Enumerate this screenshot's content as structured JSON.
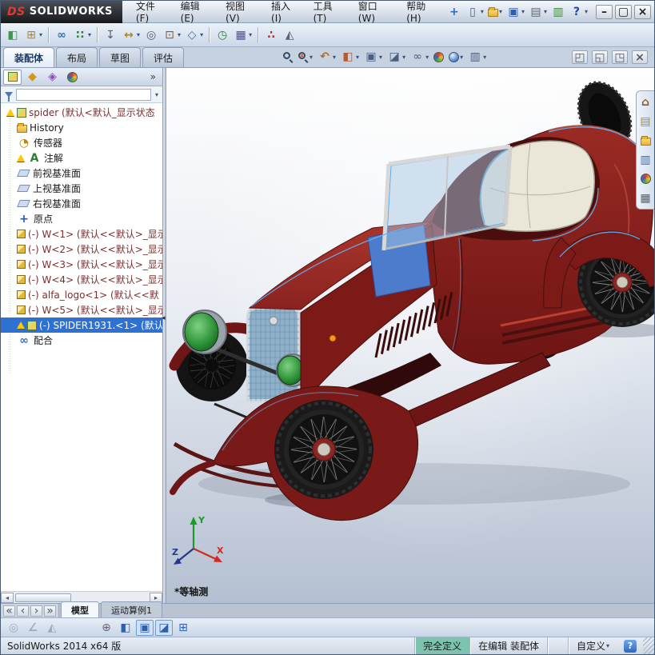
{
  "titlebar": {
    "logo_mark": "DS",
    "logo_text": "SOLIDWORKS",
    "menus": [
      {
        "name": "file",
        "label": "文件(F)"
      },
      {
        "name": "edit",
        "label": "编辑(E)"
      },
      {
        "name": "view",
        "label": "视图(V)"
      },
      {
        "name": "insert",
        "label": "插入(I)"
      },
      {
        "name": "tools",
        "label": "工具(T)"
      },
      {
        "name": "window",
        "label": "窗口(W)"
      },
      {
        "name": "help",
        "label": "帮助(H)"
      }
    ],
    "buttons": [
      {
        "name": "pin-menubar",
        "icon": "pin"
      },
      {
        "name": "new-document",
        "icon": "new-doc",
        "caret": true
      },
      {
        "name": "open-document",
        "icon": "open",
        "caret": true
      },
      {
        "name": "save-document",
        "icon": "save",
        "caret": true
      },
      {
        "name": "print-document",
        "icon": "print",
        "caret": true
      },
      {
        "name": "solidworks-resources",
        "icon": "toolbox"
      },
      {
        "name": "help",
        "label": "?",
        "caret": true
      }
    ],
    "window_buttons": [
      {
        "name": "minimize",
        "icon": "minimize"
      },
      {
        "name": "maximize",
        "icon": "maximize"
      },
      {
        "name": "close",
        "icon": "close"
      }
    ]
  },
  "toolbar_assembly": {
    "buttons": [
      {
        "name": "edit-component",
        "icon": "edit-component"
      },
      {
        "name": "insert-components",
        "icon": "insert-components",
        "caret": true
      },
      {
        "sep": true
      },
      {
        "name": "mate",
        "icon": "mate"
      },
      {
        "name": "linear-component-pattern",
        "icon": "pattern",
        "caret": true
      },
      {
        "sep": true
      },
      {
        "name": "smart-fasteners",
        "icon": "fasteners"
      },
      {
        "name": "move-component",
        "icon": "move",
        "caret": true
      },
      {
        "name": "show-hidden-components",
        "icon": "hidden"
      },
      {
        "name": "assembly-features",
        "icon": "asm-features",
        "caret": true
      },
      {
        "name": "reference-geometry",
        "icon": "refgeo",
        "caret": true
      },
      {
        "sep": true
      },
      {
        "name": "new-motion-study",
        "icon": "motion"
      },
      {
        "name": "bill-of-materials",
        "icon": "bom",
        "caret": true
      },
      {
        "sep": true
      },
      {
        "name": "exploded-view",
        "icon": "explode"
      },
      {
        "name": "instant-3d",
        "icon": "instant3d"
      }
    ]
  },
  "command_tabs": [
    {
      "name": "assembly",
      "label": "装配体",
      "active": true
    },
    {
      "name": "layout",
      "label": "布局"
    },
    {
      "name": "sketch",
      "label": "草图"
    },
    {
      "name": "evaluate",
      "label": "评估"
    }
  ],
  "headsup": {
    "buttons": [
      {
        "name": "zoom-to-fit",
        "icon": "mag"
      },
      {
        "name": "zoom-to-area",
        "icon": "magarea",
        "caret": true
      },
      {
        "name": "previous-view",
        "icon": "prev",
        "caret": true
      },
      {
        "name": "section-view",
        "icon": "section",
        "caret": true
      },
      {
        "name": "view-orientation",
        "icon": "vieworient",
        "caret": true
      },
      {
        "name": "display-style",
        "icon": "dispstyle",
        "caret": true
      },
      {
        "name": "hide-show-items",
        "icon": "hideshow",
        "caret": true
      },
      {
        "name": "edit-appearance",
        "icon": "ball"
      },
      {
        "name": "apply-scene",
        "icon": "scene",
        "caret": true
      },
      {
        "name": "view-settings",
        "icon": "viewset",
        "caret": true
      }
    ]
  },
  "doc_window_buttons": [
    {
      "name": "pane-restore",
      "icon": "pane-a"
    },
    {
      "name": "pane-split",
      "icon": "pane-b"
    },
    {
      "name": "pane-float",
      "icon": "pane-c"
    },
    {
      "name": "pane-close",
      "icon": "pane-x"
    }
  ],
  "panel": {
    "tabs": [
      {
        "name": "feature-manager",
        "icon": "fm",
        "active": true
      },
      {
        "name": "property-manager",
        "icon": "pm"
      },
      {
        "name": "configuration-manager",
        "icon": "cm"
      },
      {
        "name": "display-manager",
        "icon": "dm"
      }
    ],
    "overflow_label": "»"
  },
  "feature_tree": {
    "items": [
      {
        "name": "root-spider",
        "label": "spider (默认<默认_显示状态",
        "icon": "assembly",
        "warning": true,
        "tone": "component",
        "indent": 0
      },
      {
        "name": "history",
        "label": "History",
        "icon": "history",
        "indent": 1
      },
      {
        "name": "sensors",
        "label": "传感器",
        "icon": "sensors",
        "indent": 1
      },
      {
        "name": "annotations",
        "label": "注解",
        "icon": "annotations",
        "warning": true,
        "indent": 1
      },
      {
        "name": "front-plane",
        "label": "前视基准面",
        "icon": "plane",
        "indent": 1
      },
      {
        "name": "top-plane",
        "label": "上视基准面",
        "icon": "plane",
        "indent": 1
      },
      {
        "name": "right-plane",
        "label": "右视基准面",
        "icon": "plane",
        "indent": 1
      },
      {
        "name": "origin",
        "label": "原点",
        "icon": "origin",
        "indent": 1
      },
      {
        "name": "component-w1",
        "label": "(-) W<1> (默认<<默认>_显示",
        "icon": "part",
        "tone": "component",
        "indent": 1
      },
      {
        "name": "component-w2",
        "label": "(-) W<2> (默认<<默认>_显示",
        "icon": "part",
        "tone": "component",
        "indent": 1
      },
      {
        "name": "component-w3",
        "label": "(-) W<3> (默认<<默认>_显示",
        "icon": "part",
        "tone": "component",
        "indent": 1
      },
      {
        "name": "component-w4",
        "label": "(-) W<4> (默认<<默认>_显示",
        "icon": "part",
        "tone": "component",
        "indent": 1
      },
      {
        "name": "component-alfa-logo",
        "label": "(-) alfa_logo<1> (默认<<默",
        "icon": "part",
        "tone": "component",
        "indent": 1
      },
      {
        "name": "component-w5",
        "label": "(-) W<5> (默认<<默认>_显示",
        "icon": "part",
        "tone": "component",
        "indent": 1
      },
      {
        "name": "component-spider1931",
        "label": "(-) SPIDER1931.<1> (默认",
        "icon": "assembly",
        "warning": true,
        "selected": true,
        "indent": 1
      },
      {
        "name": "mates",
        "label": "配合",
        "icon": "mates",
        "indent": 1
      }
    ]
  },
  "taskpane": {
    "items": [
      {
        "name": "solidworks-resources",
        "icon": "home"
      },
      {
        "name": "design-library",
        "icon": "library"
      },
      {
        "name": "file-explorer",
        "icon": "folder"
      },
      {
        "name": "view-palette",
        "icon": "palette"
      },
      {
        "name": "appearances-scenes",
        "icon": "ball"
      },
      {
        "name": "custom-properties",
        "icon": "props"
      }
    ]
  },
  "viewport": {
    "view_label": "*等轴测",
    "triad": {
      "x_label": "X",
      "y_label": "Y",
      "z_label": "Z"
    }
  },
  "model_tab_bar": {
    "nav": [
      {
        "name": "first-tab",
        "icon": "nav-first"
      },
      {
        "name": "previous-tab",
        "icon": "nav-prev"
      },
      {
        "name": "next-tab",
        "icon": "nav-next"
      },
      {
        "name": "last-tab",
        "icon": "nav-last"
      }
    ],
    "tabs": [
      {
        "name": "model",
        "label": "模型",
        "active": true
      },
      {
        "name": "motion-study-1",
        "label": "运动算例1"
      }
    ]
  },
  "toolbar_bottom": {
    "buttons": [
      {
        "name": "hide-all-types",
        "icon": "b-eye",
        "disabled": true
      },
      {
        "name": "measure",
        "icon": "b-angle",
        "disabled": true
      },
      {
        "name": "mass-properties",
        "icon": "b-mass",
        "disabled": true
      },
      {
        "space": true
      },
      {
        "name": "quick-snaps",
        "icon": "b-snap"
      },
      {
        "name": "section-view",
        "icon": "b-section"
      },
      {
        "name": "view-orientation",
        "icon": "b-vieworient",
        "active": true
      },
      {
        "name": "display-style",
        "icon": "b-dispstyle",
        "active": true
      },
      {
        "name": "grid-system",
        "icon": "b-grid"
      }
    ]
  },
  "statusbar": {
    "app_version": "SolidWorks 2014 x64 版",
    "define_state": "完全定义",
    "edit_state": "在编辑 装配体",
    "custom": "自定义",
    "help": "?"
  },
  "colors": {
    "body_red": "#8e2222",
    "accent_blue": "#4d7ccd",
    "edge_highlight": "#63b4f2",
    "selection_blue": "#2f71d0",
    "warning_yellow": "#ffc800"
  }
}
